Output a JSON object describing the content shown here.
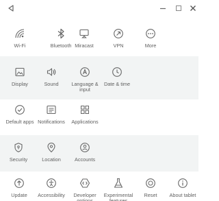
{
  "window": {
    "back_icon": "back-triangle-icon",
    "min_icon": "minimize-icon",
    "max_icon": "maximize-icon",
    "close_icon": "close-icon"
  },
  "sections": {
    "network": {
      "items": [
        {
          "label": "Wi-Fi",
          "icon": "wifi-icon"
        },
        {
          "label": "Bluetooth",
          "icon": "bluetooth-icon"
        },
        {
          "label": "Miracast",
          "icon": "miracast-icon"
        },
        {
          "label": "VPN",
          "icon": "vpn-icon"
        },
        {
          "label": "More",
          "icon": "more-icon"
        }
      ]
    },
    "device": {
      "items": [
        {
          "label": "Display",
          "icon": "display-icon"
        },
        {
          "label": "Sound",
          "icon": "sound-icon"
        },
        {
          "label": "Language &\ninput",
          "icon": "language-icon"
        },
        {
          "label": "Date & time",
          "icon": "clock-icon"
        }
      ]
    },
    "apps": {
      "items": [
        {
          "label": "Default apps",
          "icon": "default-apps-icon"
        },
        {
          "label": "Notifications",
          "icon": "notifications-icon"
        },
        {
          "label": "Applications",
          "icon": "applications-icon"
        }
      ]
    },
    "privacy": {
      "items": [
        {
          "label": "Security",
          "icon": "security-icon"
        },
        {
          "label": "Location",
          "icon": "location-icon"
        },
        {
          "label": "Accounts",
          "icon": "accounts-icon"
        }
      ]
    },
    "system": {
      "items": [
        {
          "label": "Update",
          "icon": "update-icon"
        },
        {
          "label": "Accessibility",
          "icon": "accessibility-icon"
        },
        {
          "label": "Developer\noptions",
          "icon": "developer-icon"
        },
        {
          "label": "Experimental\nfeatures",
          "icon": "flask-icon"
        },
        {
          "label": "Reset",
          "icon": "reset-icon"
        },
        {
          "label": "About tablet",
          "icon": "info-icon"
        }
      ]
    }
  }
}
